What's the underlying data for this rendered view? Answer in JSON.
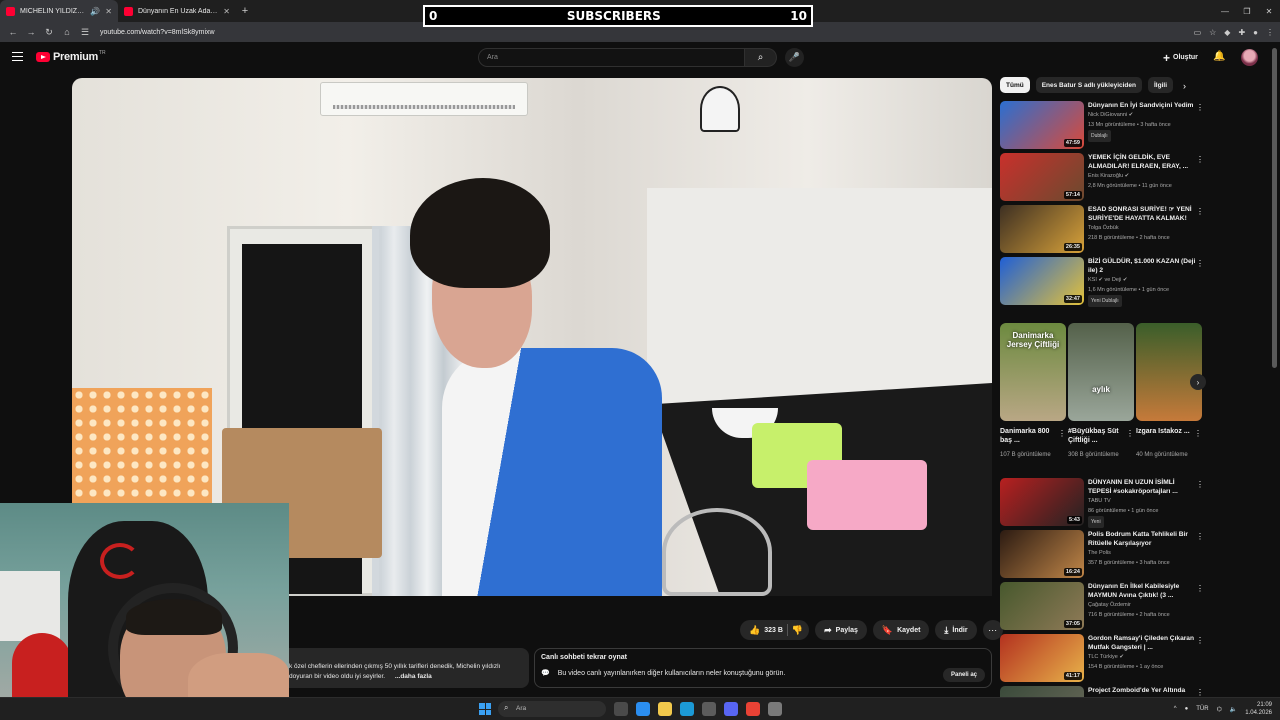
{
  "browser": {
    "tabs": [
      {
        "title": "MİCHELİN YILDIZLI SOKAK",
        "active": true
      },
      {
        "title": "Dünyanın En Uzak Adasına Git",
        "active": false
      }
    ],
    "url": "youtube.com/watch?v=8mlSk8ymixw"
  },
  "overlay": {
    "left_count": "0",
    "label": "SUBSCRIBERS",
    "right_count": "10"
  },
  "header": {
    "brand": "Premium",
    "country": "TR",
    "search_placeholder": "Ara",
    "create_label": "Oluştur"
  },
  "video": {
    "like_count": "323 B",
    "share_label": "Paylaş",
    "save_label": "Kaydet",
    "download_label": "İndir",
    "description_line1": "k özel cheflerin ellerinden çıkmış 50 yıllık tarifleri denedik, Michelin yıldızlı",
    "description_line2": "doyuran bir video oldu iyi seyirler.",
    "description_more": "...daha fazla"
  },
  "chat": {
    "title": "Canlı sohbeti tekrar oynat",
    "body": "Bu video canlı yayınlanırken diğer kullanıcıların neler konuştuğunu görün.",
    "button": "Paneli aç"
  },
  "chips": [
    "Tümü",
    "Enes Batur S adlı yükleyiciden",
    "İlgili"
  ],
  "recommendations_top": [
    {
      "title": "Dünyanın En İyi Sandviçini Yedim",
      "channel": "Nick DiGiovanni ✔",
      "meta": "13 Mn görüntüleme • 3 hafta önce",
      "badge": "Dublajlı",
      "duration": "47:59",
      "c1": "#2b6fd1",
      "c2": "#d94a3a"
    },
    {
      "title": "YEMEK İÇİN GELDİK, EVE ALMADILAR! ELRAEN, ERAY, ...",
      "channel": "Enis Kirazoğlu ✔",
      "meta": "2,8 Mn görüntüleme • 11 gün önce",
      "badge": "",
      "duration": "57:14",
      "c1": "#c9302c",
      "c2": "#6b4a2f"
    },
    {
      "title": "ESAD SONRASI SURİYE! ☞ YENİ SURİYE'DE HAYATTA KALMAK!",
      "channel": "Tolga Özbük",
      "meta": "218 B görüntüleme • 2 hafta önce",
      "badge": "",
      "duration": "26:35",
      "c1": "#3d2f22",
      "c2": "#d8a23a"
    },
    {
      "title": "BİZİ GÜLDÜR, $1.000 KAZAN (Deji ile) 2",
      "channel": "KSI ✔ ve Deji ✔",
      "meta": "1,6 Mn görüntüleme • 1 gün önce",
      "badge": "Yeni   Dublajlı",
      "duration": "32:47",
      "c1": "#1f5fd6",
      "c2": "#e4c23a"
    }
  ],
  "shorts": [
    {
      "title": "Danimarka 800 baş ...",
      "meta": "107 B görüntüleme",
      "label": "Danimarka Jersey Çiftliği",
      "c1": "#6c8a3f",
      "c2": "#b9a785"
    },
    {
      "title": "#Büyükbaş Süt Çiftliği ...",
      "meta": "308 B görüntüleme",
      "label": "aylık",
      "c1": "#54614a",
      "c2": "#9aa69a"
    },
    {
      "title": "Izgara Istakoz ...",
      "meta": "40 Mn görüntüleme",
      "label": "",
      "c1": "#3a5e2a",
      "c2": "#c67a3a"
    }
  ],
  "recommendations_bottom": [
    {
      "title": "DÜNYANIN EN UZUN İSİMLİ TEPESİ #sokakröportajları ...",
      "channel": "TABU TV",
      "meta": "86 görüntüleme • 1 gün önce",
      "badge": "Yeni",
      "duration": "5:43",
      "c1": "#b82020",
      "c2": "#222"
    },
    {
      "title": "Polis Bodrum Katta Tehlikeli Bir Ritüelle Karşılaşıyor",
      "channel": "The Polis",
      "meta": "357 B görüntüleme • 3 hafta önce",
      "badge": "",
      "duration": "16:24",
      "c1": "#2c1b12",
      "c2": "#c08648"
    },
    {
      "title": "Dünyanın En İlkel Kabilesiyle MAYMUN Avına Çıktık! (3 ...",
      "channel": "Çağatay Özdemir",
      "meta": "716 B görüntüleme • 2 hafta önce",
      "badge": "",
      "duration": "37:05",
      "c1": "#47582d",
      "c2": "#8f7a57"
    },
    {
      "title": "Gordon Ramsay'i Çileden Çıkaran Mutfak Gangsteri | ...",
      "channel": "TLC Türkiye ✔",
      "meta": "154 B görüntüleme • 1 ay önce",
      "badge": "",
      "duration": "41:17",
      "c1": "#b3311f",
      "c2": "#e8b24a"
    },
    {
      "title": "Project Zomboid'de Yer Altında",
      "channel": "",
      "meta": "",
      "badge": "",
      "duration": "",
      "c1": "#3a4a3a",
      "c2": "#6a6a5a"
    }
  ],
  "taskbar": {
    "search": "Ara",
    "time": "21:09",
    "date": "1.04.2026",
    "lang": "TÜR"
  }
}
